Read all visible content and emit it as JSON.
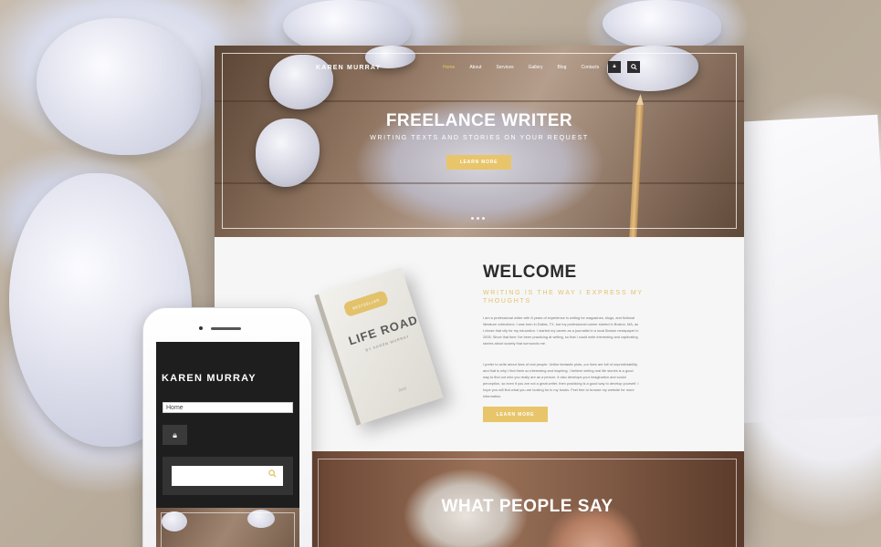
{
  "desktop": {
    "logo": "KAREN MURRAY",
    "nav": [
      "Home",
      "About",
      "Services",
      "Gallery",
      "Blog",
      "Contacts"
    ],
    "lock_icon": "lock-icon",
    "search_icon": "search-icon",
    "hero": {
      "title": "FREELANCE WRITER",
      "subtitle": "WRITING TEXTS AND STORIES ON YOUR REQUEST",
      "button": "LEARN MORE"
    },
    "book": {
      "badge": "BESTSELLER",
      "title": "LIFE ROAD",
      "author": "BY KAREN MURRAY",
      "year": "2015"
    },
    "welcome": {
      "title": "WELCOME",
      "subtitle": "WRITING IS THE WAY I EXPRESS MY THOUGHTS",
      "paragraph1": "I am a professional writer with 8 years of experience in writing for magazines, blogs, and fictional literature collections. I was born in Dallas, TX, but my professional career started in Boston, MA, as I chose that city for my education. I started my career as a journalist in a local Boston newspaper in 2005. Since that time I've been practicing at writing, so that I could write interesting and captivating stories about society that surrounds me.",
      "paragraph2": "I prefer to write about lives of real people. Unlike fantastic plots, our lives are full of unpredictability, and that is why I find them so interesting and inspiring. I believe writing real life stories is a good way to find out who you really are as a person. It also develops your imagination and social perception, so even if you are not a great writer, then practicing is a good way to develop yourself. I hope you will find what you are looking for in my books. Feel free to browse my website for more information.",
      "button": "LEARN MORE"
    },
    "testimonials": {
      "title": "WHAT PEOPLE SAY"
    }
  },
  "mobile": {
    "logo": "KAREN MURRAY",
    "menu_selected": "Home",
    "lock_icon": "lock-icon",
    "search_icon": "search-icon"
  },
  "colors": {
    "accent": "#e8c56a",
    "dark": "#1e1e1e"
  }
}
